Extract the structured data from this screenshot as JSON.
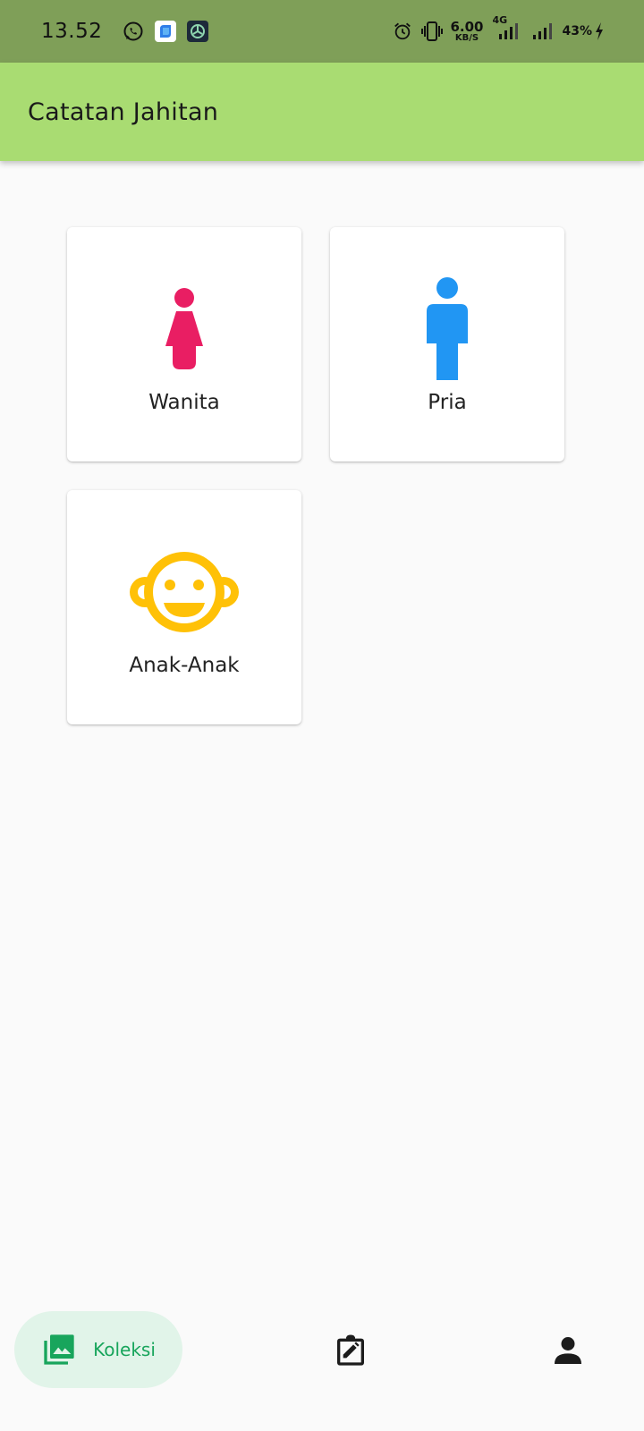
{
  "status_bar": {
    "time": "13.52",
    "net_speed_value": "6.00",
    "net_speed_unit": "KB/S",
    "network_type": "4G",
    "battery": "43%",
    "icons": [
      "whatsapp-icon",
      "app-notification-icon",
      "vpn-notification-icon",
      "alarm-icon",
      "vibrate-icon",
      "signal-icon",
      "battery-charging-icon"
    ]
  },
  "app_bar": {
    "title": "Catatan Jahitan"
  },
  "categories": [
    {
      "label": "Wanita",
      "icon": "woman-icon",
      "color": "#e91e63"
    },
    {
      "label": "Pria",
      "icon": "man-icon",
      "color": "#2196f3"
    },
    {
      "label": "Anak-Anak",
      "icon": "child-face-icon",
      "color": "#ffc107"
    }
  ],
  "bottom_nav": {
    "items": [
      {
        "label": "Koleksi",
        "icon": "collections-icon",
        "active": true
      },
      {
        "label": "",
        "icon": "edit-clipboard-icon",
        "active": false
      },
      {
        "label": "",
        "icon": "person-icon",
        "active": false
      }
    ],
    "active_color": "#18a55c",
    "active_bg": "#e1f4e9"
  },
  "colors": {
    "status_bar_bg": "#7f9f58",
    "app_bar_bg": "#a9dc72",
    "page_bg": "#fafafa"
  }
}
